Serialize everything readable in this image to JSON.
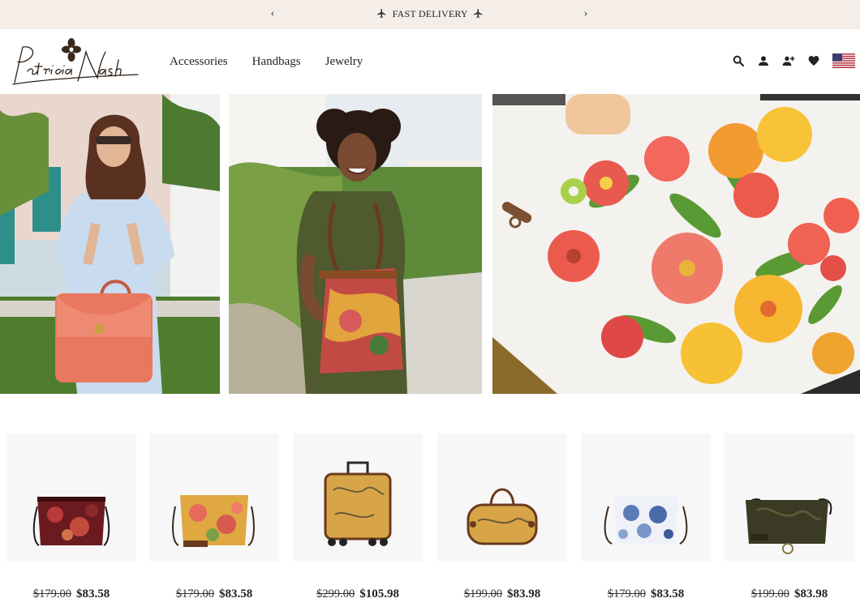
{
  "promo": {
    "prev_label": "‹",
    "next_label": "›",
    "message": "FAST DELIVERY"
  },
  "header": {
    "logo_text": "Patricia Nash",
    "nav": [
      "Accessories",
      "Handbags",
      "Jewelry"
    ],
    "icons": [
      "search-icon",
      "account-icon",
      "add-user-icon",
      "wishlist-heart-icon",
      "us-flag-icon"
    ]
  },
  "hero": {
    "panels": [
      "woman-coral-handbag-photo",
      "woman-floral-bucket-bag-photo",
      "floral-painting-photo"
    ]
  },
  "products": [
    {
      "name": "red floral crossbody bag",
      "old_price": "$179.00",
      "new_price": "$83.58",
      "color": "#7a1d22"
    },
    {
      "name": "yellow floral crossbody bag",
      "old_price": "$179.00",
      "new_price": "$83.58",
      "color": "#d9a13a"
    },
    {
      "name": "map print rolling suitcase",
      "old_price": "$299.00",
      "new_price": "$105.98",
      "color": "#d7a548"
    },
    {
      "name": "map print duffel bag",
      "old_price": "$199.00",
      "new_price": "$83.98",
      "color": "#d7a548"
    },
    {
      "name": "blue tile crossbody bag",
      "old_price": "$179.00",
      "new_price": "$83.58",
      "color": "#9fb3d3"
    },
    {
      "name": "olive tooled leather bag",
      "old_price": "$199.00",
      "new_price": "$83.98",
      "color": "#3b3a24"
    }
  ]
}
